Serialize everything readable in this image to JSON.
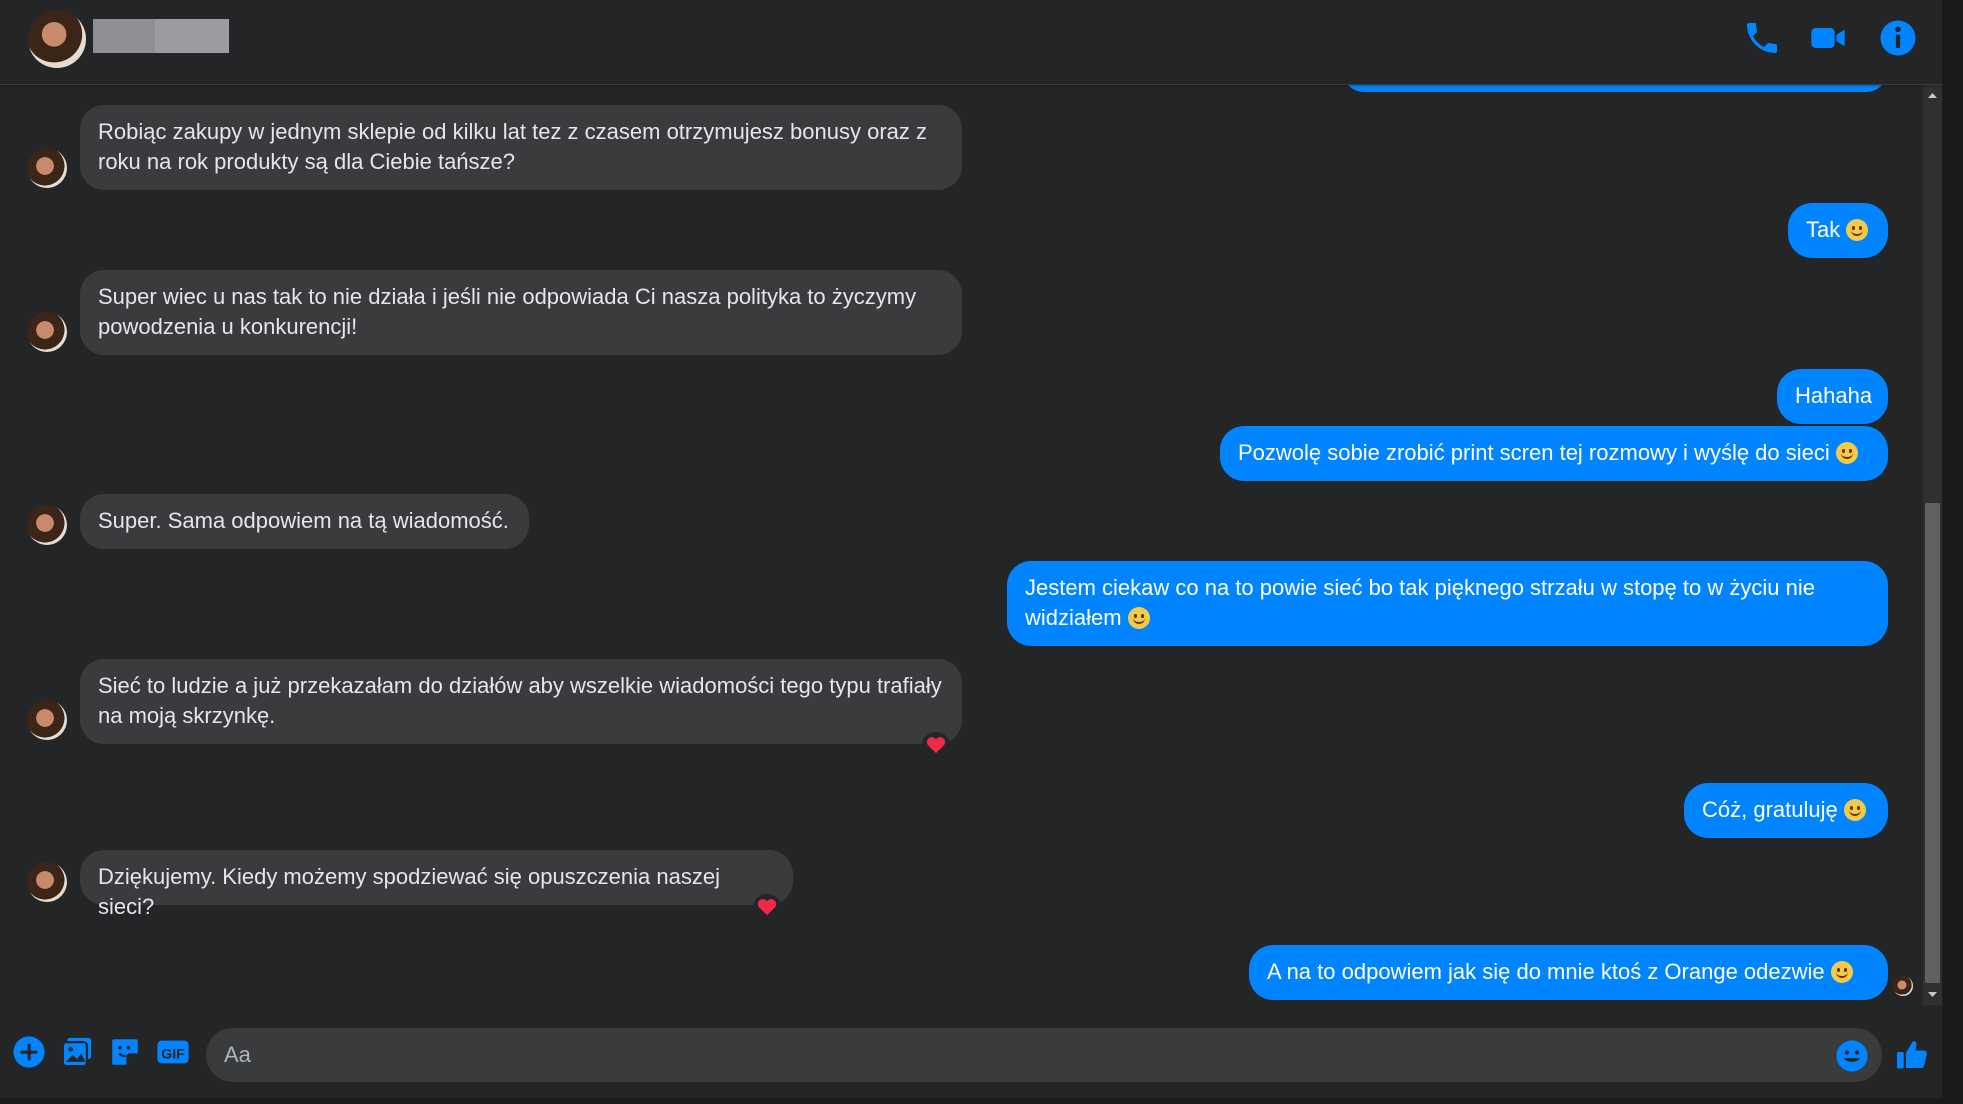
{
  "header": {
    "contact_name_redacted": true,
    "icons": [
      "phone-icon",
      "video-icon",
      "info-icon"
    ]
  },
  "messages": [
    {
      "side": "in",
      "text": "Robiąc zakupy w jednym sklepie od kilku lat tez z czasem otrzymujesz bonusy oraz z roku na rok produkty są dla Ciebie tańsze?"
    },
    {
      "side": "out",
      "text": "Tak",
      "emoji": true
    },
    {
      "side": "in",
      "text": "Super wiec u nas tak to nie działa i jeśli nie odpowiada Ci nasza polityka to życzymy powodzenia u konkurencji!"
    },
    {
      "side": "out",
      "text": "Hahaha"
    },
    {
      "side": "out",
      "text": "Pozwolę sobie zrobić print scren tej rozmowy i wyślę do sieci",
      "emoji": true
    },
    {
      "side": "in",
      "text": "Super. Sama odpowiem na tą wiadomość."
    },
    {
      "side": "out",
      "text": "Jestem ciekaw co na to powie sieć bo tak pięknego strzału w stopę to w życiu nie widziałem",
      "emoji": true
    },
    {
      "side": "in",
      "text": "Sieć to ludzie a już przekazałam do działów aby wszelkie wiadomości tego typu trafiały na moją skrzynkę.",
      "reaction": "heart"
    },
    {
      "side": "out",
      "text": "Cóż, gratuluję",
      "emoji": true
    },
    {
      "side": "in",
      "text": "Dziękujemy. Kiedy możemy spodziewać się opuszczenia naszej sieci?",
      "reaction": "heart"
    },
    {
      "side": "out",
      "text": "A na to odpowiem jak się do mnie ktoś z Orange odezwie",
      "emoji": true
    }
  ],
  "composer": {
    "placeholder": "Aa",
    "icons": [
      "add-icon",
      "image-icon",
      "sticker-icon",
      "gif-icon",
      "emoji-icon",
      "thumbs-up-icon"
    ],
    "gif_label": "GIF"
  },
  "colors": {
    "background": "#242526",
    "incoming_bubble": "#3a3b3c",
    "outgoing_bubble": "#0084ff",
    "accent": "#0084ff"
  }
}
